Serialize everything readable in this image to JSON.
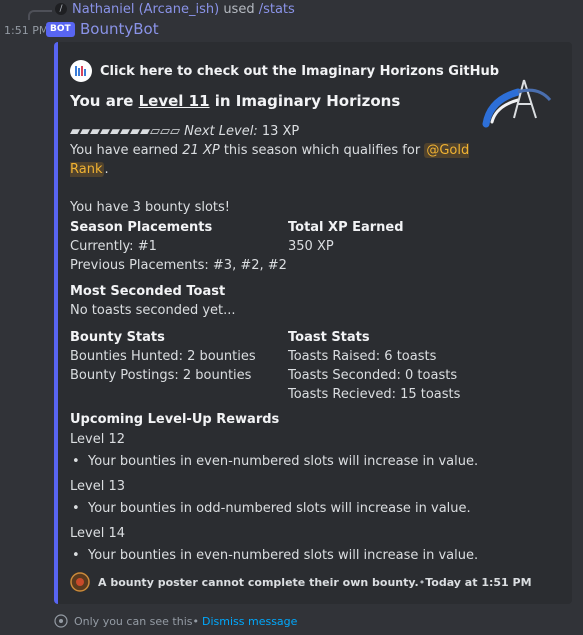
{
  "reply": {
    "command_icon": "/",
    "user": "Nathaniel (Arcane_ish)",
    "used": "used",
    "command": "/stats"
  },
  "message": {
    "time": "1:51 PM",
    "bot_tag": "BOT",
    "bot_name": "BountyBot"
  },
  "embed": {
    "accent_color": "#5865f2",
    "author": "Click here to check out the Imaginary Horizons GitHub",
    "title_prefix": "You are ",
    "title_level": "Level 11",
    "title_suffix": " in Imaginary Horizons",
    "progress_bar": "▰▰▰▰▰▰▰▰▱▱▱",
    "progress_filled": 8,
    "progress_total": 11,
    "next_level_label": "Next Level:",
    "next_level_xp": "13 XP",
    "earned_prefix": "You have earned ",
    "earned_xp": "21 XP",
    "earned_suffix": " this season which qualifies for ",
    "rank_mention": "@Gold Rank",
    "rank_period": ".",
    "bounty_slots": "You have 3 bounty slots!",
    "fields": {
      "season": {
        "name": "Season Placements",
        "current": "Currently: #1",
        "previous": "Previous Placements: #3, #2, #2"
      },
      "total_xp": {
        "name": "Total XP Earned",
        "value": "350 XP"
      },
      "most_seconded": {
        "name": "Most Seconded Toast",
        "value": "No toasts seconded yet..."
      },
      "bounty_stats": {
        "name": "Bounty Stats",
        "hunted": "Bounties Hunted: 2 bounties",
        "postings": "Bounty Postings: 2 bounties"
      },
      "toast_stats": {
        "name": "Toast Stats",
        "raised": "Toasts Raised: 6 toasts",
        "seconded": "Toasts Seconded: 0 toasts",
        "received": "Toasts Recieved: 15 toasts"
      },
      "rewards": {
        "name": "Upcoming Level-Up Rewards",
        "levels": [
          {
            "level": "Level 12",
            "reward": "Your bounties in even-numbered slots will increase in value."
          },
          {
            "level": "Level 13",
            "reward": "Your bounties in odd-numbered slots will increase in value."
          },
          {
            "level": "Level 14",
            "reward": "Your bounties in even-numbered slots will increase in value."
          }
        ]
      }
    },
    "footer_text": "A bounty poster cannot complete their own bounty.",
    "footer_sep": " • ",
    "footer_time": "Today at 1:51 PM"
  },
  "ephemeral": {
    "text": "Only you can see this",
    "sep": " • ",
    "dismiss": "Dismiss message"
  },
  "icons": {
    "author": "github-logo-icon",
    "thumbnail": "imaginary-horizons-logo-icon",
    "footer": "bounty-icon",
    "eye": "eye-icon"
  }
}
